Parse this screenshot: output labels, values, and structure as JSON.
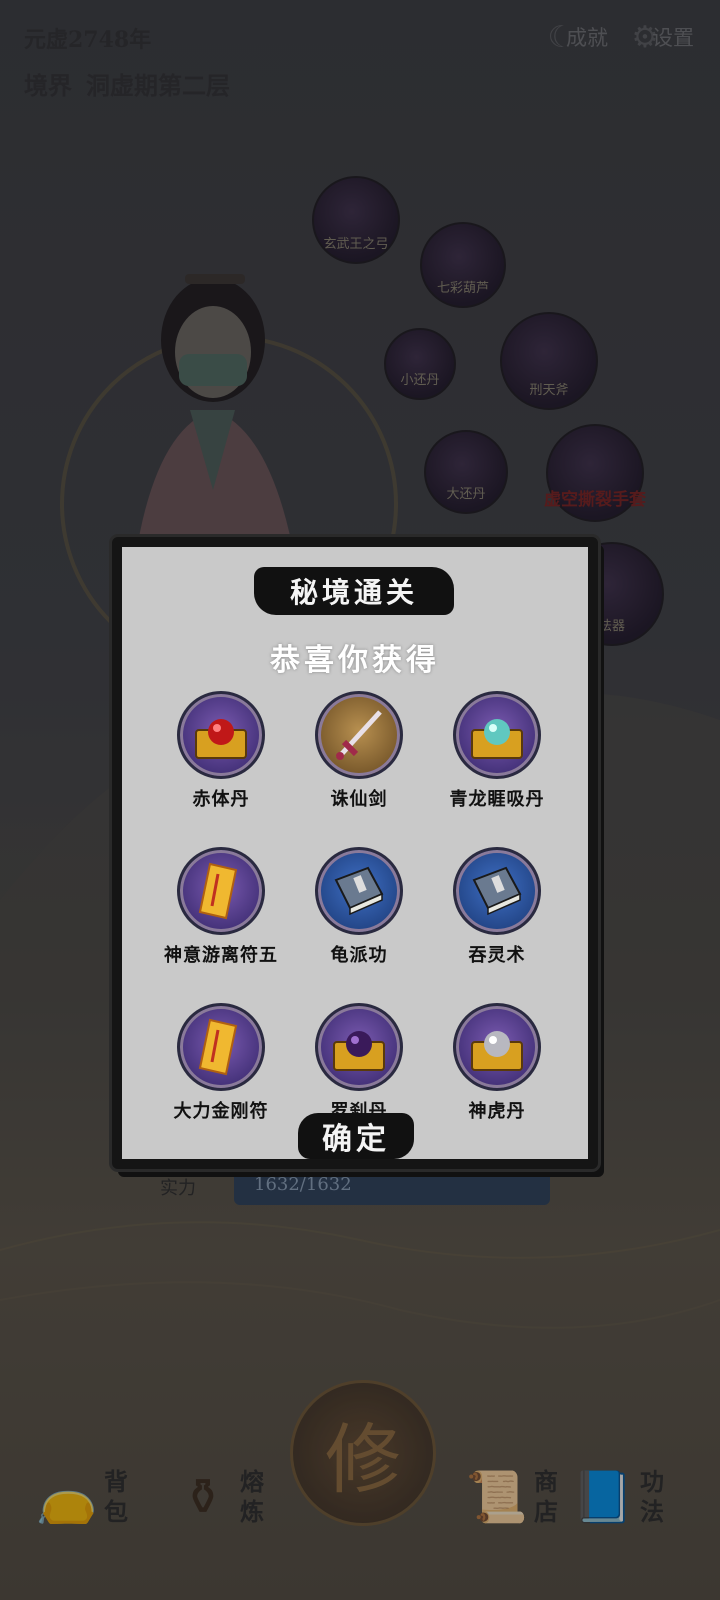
{
  "hud": {
    "era": "元虚2748年",
    "realm_label": "境界",
    "realm_value": "洞虚期第二层",
    "achievements_label": "成就",
    "settings_label": "设置"
  },
  "orbs": [
    {
      "label": "玄武王之弓"
    },
    {
      "label": "七彩葫芦"
    },
    {
      "label": "小还丹"
    },
    {
      "label": "刑天斧"
    },
    {
      "label": "大还丹"
    },
    {
      "label": "虚空撕裂手套"
    },
    {
      "label": "法器"
    }
  ],
  "modal": {
    "title": "秘境通关",
    "subtitle": "恭喜你获得",
    "items": [
      {
        "name": "赤体丹",
        "icon": "red-pill-chest-icon"
      },
      {
        "name": "诛仙剑",
        "icon": "sword-icon"
      },
      {
        "name": "青龙睚吸丹",
        "icon": "cyan-pill-chest-icon"
      },
      {
        "name": "神意游离符五",
        "icon": "talisman-icon"
      },
      {
        "name": "龟派功",
        "icon": "book-icon"
      },
      {
        "name": "吞灵术",
        "icon": "book-icon"
      },
      {
        "name": "大力金刚符",
        "icon": "talisman-icon"
      },
      {
        "name": "罗刹丹",
        "icon": "purple-pill-chest-icon"
      },
      {
        "name": "神虎丹",
        "icon": "silver-pill-chest-icon"
      }
    ],
    "confirm_label": "确定"
  },
  "background_status": {
    "label": "实力",
    "value": "1632/1632"
  },
  "cultivate_label": "修",
  "nav": {
    "bag": "背包",
    "refine": "熔炼",
    "shop": "商店",
    "skills": "功法"
  }
}
